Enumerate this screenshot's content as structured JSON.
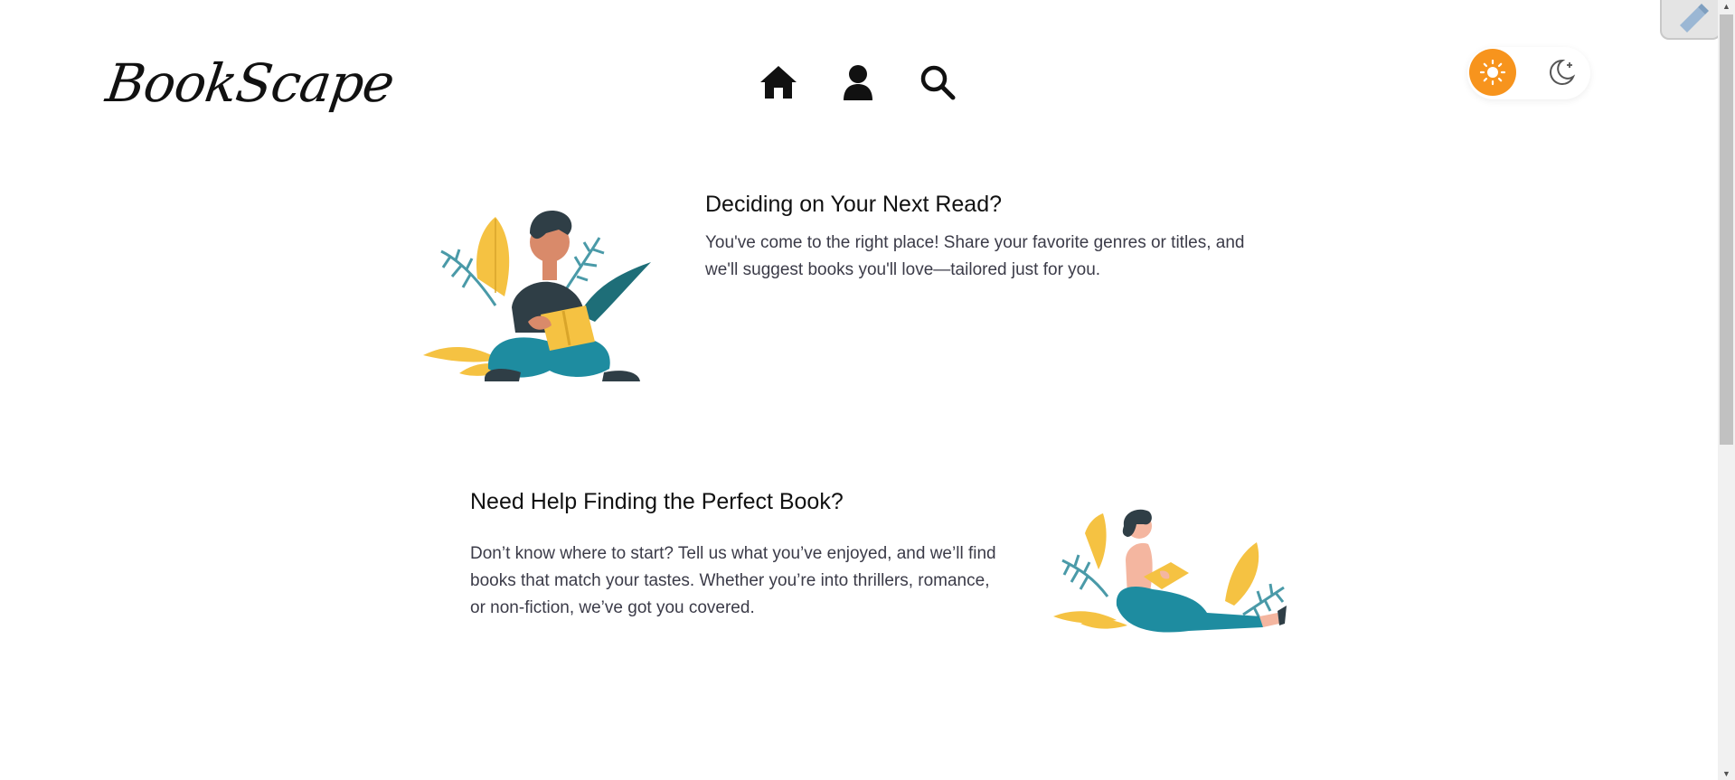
{
  "header": {
    "logo": "BookScape",
    "nav": [
      {
        "icon": "home-icon"
      },
      {
        "icon": "user-icon"
      },
      {
        "icon": "search-icon"
      }
    ],
    "theme": {
      "light_icon": "sun-icon",
      "dark_icon": "moon-icon",
      "active": "light",
      "accent": "#f7941d"
    }
  },
  "sections": [
    {
      "title": "Deciding on Your Next Read?",
      "text": "You've come to the right place! Share your favorite genres or titles, and we'll suggest books you'll love—tailored just for you.",
      "illustration": "man-reading-illustration"
    },
    {
      "title": "Need Help Finding the Perfect Book?",
      "text": "Don’t know where to start? Tell us what you’ve enjoyed, and we’ll find books that match your tastes. Whether you’re into thrillers, romance, or non-fiction, we’ve got you covered.",
      "illustration": "woman-reading-illustration"
    }
  ],
  "colors": {
    "teal": "#1e8ca0",
    "yellow": "#f5c242",
    "dark": "#2f3e46",
    "skin": "#d98a6a"
  }
}
